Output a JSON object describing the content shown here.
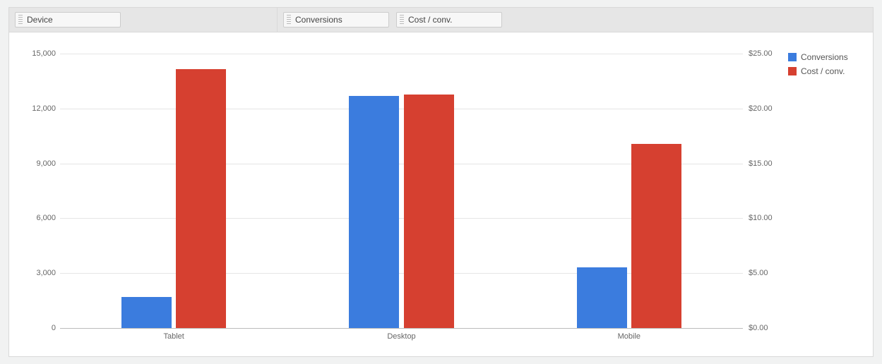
{
  "header": {
    "dimension_pill": "Device",
    "metric_pill_1": "Conversions",
    "metric_pill_2": "Cost / conv."
  },
  "legend": {
    "series1": "Conversions",
    "series2": "Cost / conv."
  },
  "colors": {
    "series1": "#3b7cde",
    "series2": "#d64030"
  },
  "y1_ticks": [
    "0",
    "3,000",
    "6,000",
    "9,000",
    "12,000",
    "15,000"
  ],
  "y2_ticks": [
    "$0.00",
    "$5.00",
    "$10.00",
    "$15.00",
    "$20.00",
    "$25.00"
  ],
  "x_categories": [
    "Tablet",
    "Desktop",
    "Mobile"
  ],
  "chart_data": {
    "type": "bar",
    "categories": [
      "Tablet",
      "Desktop",
      "Mobile"
    ],
    "series": [
      {
        "name": "Conversions",
        "axis": "y1",
        "values": [
          1700,
          12700,
          3300
        ]
      },
      {
        "name": "Cost / conv.",
        "axis": "y2",
        "values": [
          23.6,
          21.3,
          16.8
        ]
      }
    ],
    "y1": {
      "label": "",
      "min": 0,
      "max": 15000,
      "ticks": [
        0,
        3000,
        6000,
        9000,
        12000,
        15000
      ]
    },
    "y2": {
      "label": "",
      "min": 0,
      "max": 25,
      "ticks": [
        0,
        5,
        10,
        15,
        20,
        25
      ],
      "format": "currency_usd"
    },
    "title": "",
    "xlabel": "",
    "grid": true,
    "legend_position": "right"
  }
}
